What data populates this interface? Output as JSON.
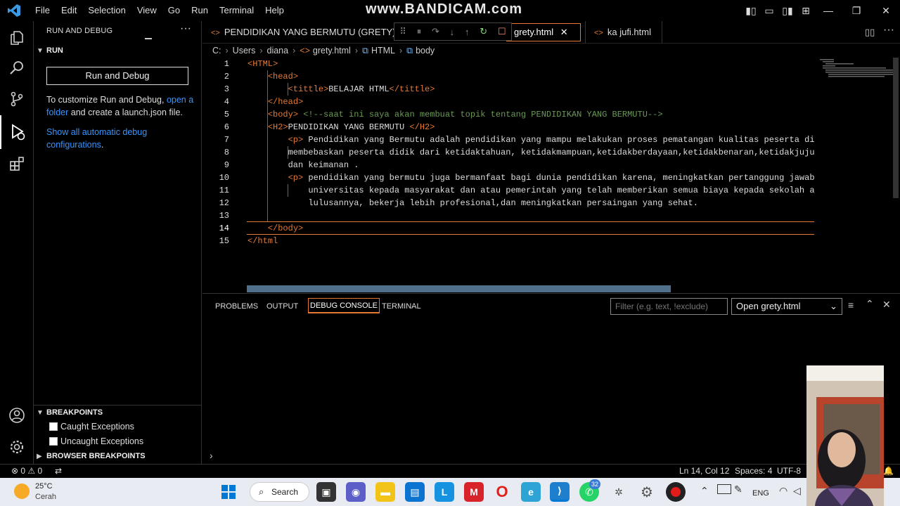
{
  "watermark": "www.BANDICAM.com",
  "menu": [
    "File",
    "Edit",
    "Selection",
    "View",
    "Go",
    "Run",
    "Terminal",
    "Help"
  ],
  "sidebar": {
    "title": "RUN AND DEBUG",
    "more": "···",
    "run_section": "RUN",
    "run_button": "Run and Debug",
    "customize_text_1": "To customize Run and Debug, ",
    "customize_link": "open a folder",
    "customize_text_2": " and create a launch.json file.",
    "show_all_link": "Show all automatic debug configurations",
    "show_all_end": ".",
    "breakpoints_section": "BREAKPOINTS",
    "breakpoints": [
      "Caught Exceptions",
      "Uncaught Exceptions"
    ],
    "browser_breakpoints": "BROWSER BREAKPOINTS"
  },
  "tabs": [
    {
      "label": "PENDIDIKAN YANG BERMUTU (GRETY).txt"
    },
    {
      "label": "grety.html",
      "close": "✕"
    },
    {
      "label": "ka jufi.html"
    }
  ],
  "breadcrumb": [
    "C:",
    "Users",
    "diana",
    "grety.html",
    "HTML",
    "body"
  ],
  "code_lines": [
    {
      "n": "1",
      "parts": [
        {
          "t": "<HTML>",
          "c": "tag"
        }
      ]
    },
    {
      "n": "2",
      "parts": [
        {
          "t": "    "
        },
        {
          "t": "<head>",
          "c": "tag"
        }
      ]
    },
    {
      "n": "3",
      "parts": [
        {
          "t": "        "
        },
        {
          "t": "<tittle>",
          "c": "tag"
        },
        {
          "t": "BELAJAR HTML"
        },
        {
          "t": "</tittle>",
          "c": "tag"
        }
      ]
    },
    {
      "n": "4",
      "parts": [
        {
          "t": "    "
        },
        {
          "t": "</head>",
          "c": "tag"
        }
      ]
    },
    {
      "n": "5",
      "parts": [
        {
          "t": "    "
        },
        {
          "t": "<body>",
          "c": "tag"
        },
        {
          "t": " "
        },
        {
          "t": "<!--saat ini saya akan membuat topik tentang PENDIDIKAN YANG BERMUTU-->",
          "c": "cmt"
        }
      ]
    },
    {
      "n": "6",
      "parts": [
        {
          "t": "    "
        },
        {
          "t": "<H2>",
          "c": "tag"
        },
        {
          "t": "PENDIDIKAN YANG BERMUTU "
        },
        {
          "t": "</H2>",
          "c": "tag"
        }
      ]
    },
    {
      "n": "7",
      "parts": [
        {
          "t": "        "
        },
        {
          "t": "<p>",
          "c": "tag"
        },
        {
          "t": " Pendidikan yang Bermutu adalah pendidikan yang mampu melakukan proses pematangan kualitas peserta di"
        }
      ]
    },
    {
      "n": "8",
      "parts": [
        {
          "t": "        membebaskan peserta didik dari ketidaktahuan, ketidakmampuan,ketidakberdayaan,ketidakbenaran,ketidakjuju"
        }
      ]
    },
    {
      "n": "9",
      "parts": [
        {
          "t": "        dan keimanan ."
        }
      ]
    },
    {
      "n": "10",
      "parts": [
        {
          "t": "        "
        },
        {
          "t": "<p>",
          "c": "tag"
        },
        {
          "t": " pendidikan yang bermutu juga bermanfaat bagi dunia pendidikan karena, meningkatkan pertanggung jawab"
        }
      ]
    },
    {
      "n": "11",
      "parts": [
        {
          "t": "            universitas kepada masyarakat dan atau pemerintah yang telah memberikan semua biaya kepada sekolah a"
        }
      ]
    },
    {
      "n": "12",
      "parts": [
        {
          "t": "            lulusannya, bekerja lebih profesional,dan meningkatkan persaingan yang sehat."
        }
      ]
    },
    {
      "n": "13",
      "parts": [
        {
          "t": ""
        }
      ]
    },
    {
      "n": "14",
      "parts": [
        {
          "t": "    "
        },
        {
          "t": "</body>",
          "c": "tag"
        }
      ]
    },
    {
      "n": "15",
      "parts": [
        {
          "t": "</html",
          "c": "tag"
        }
      ]
    }
  ],
  "panel": {
    "tabs": [
      "PROBLEMS",
      "OUTPUT",
      "DEBUG CONSOLE",
      "TERMINAL"
    ],
    "filter_placeholder": "Filter (e.g. text, !exclude)",
    "open_select": "Open grety.html",
    "prompt": "›"
  },
  "status": {
    "errors": "⊗ 0 ⚠ 0",
    "position": "Ln 14, Col 12",
    "spaces": "Spaces: 4",
    "encoding": "UTF-8"
  },
  "taskbar": {
    "temp": "25°C",
    "weather": "Cerah",
    "search": "Search",
    "lang": "ENG",
    "whatsapp_badge": "32"
  },
  "colors": {
    "accent": "#e37933",
    "link": "#3794ff",
    "taskbar": "#e8ecf2"
  }
}
